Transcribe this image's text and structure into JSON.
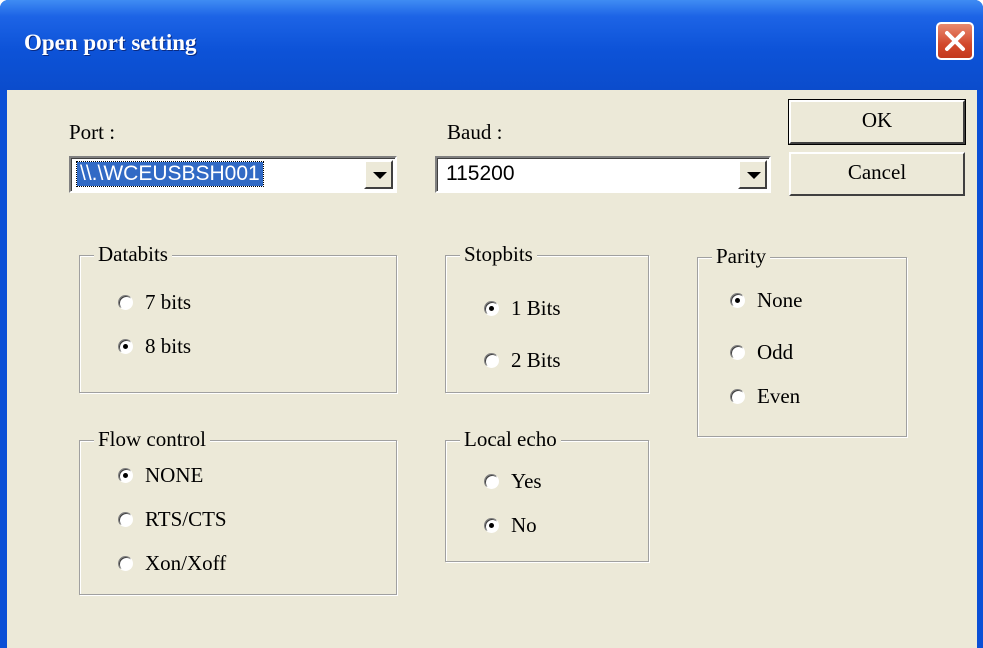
{
  "window": {
    "title": "Open port setting"
  },
  "port": {
    "label": "Port :",
    "value": "\\\\.\\WCEUSBSH001"
  },
  "baud": {
    "label": "Baud :",
    "value": "115200"
  },
  "buttons": {
    "ok": "OK",
    "cancel": "Cancel"
  },
  "databits": {
    "legend": "Databits",
    "options": [
      {
        "label": "7 bits",
        "selected": false
      },
      {
        "label": "8 bits",
        "selected": true
      }
    ]
  },
  "stopbits": {
    "legend": "Stopbits",
    "options": [
      {
        "label": "1 Bits",
        "selected": true
      },
      {
        "label": "2 Bits",
        "selected": false
      }
    ]
  },
  "parity": {
    "legend": "Parity",
    "options": [
      {
        "label": "None",
        "selected": true
      },
      {
        "label": "Odd",
        "selected": false
      },
      {
        "label": "Even",
        "selected": false
      }
    ]
  },
  "flow": {
    "legend": "Flow control",
    "options": [
      {
        "label": "NONE",
        "selected": true
      },
      {
        "label": "RTS/CTS",
        "selected": false
      },
      {
        "label": "Xon/Xoff",
        "selected": false
      }
    ]
  },
  "echo": {
    "legend": "Local echo",
    "options": [
      {
        "label": "Yes",
        "selected": false
      },
      {
        "label": "No",
        "selected": true
      }
    ]
  },
  "colors": {
    "title_bar": "#0b4ccc",
    "dialog_bg": "#ece9d8",
    "selection": "#316ac5",
    "close_button": "#d2482c"
  }
}
